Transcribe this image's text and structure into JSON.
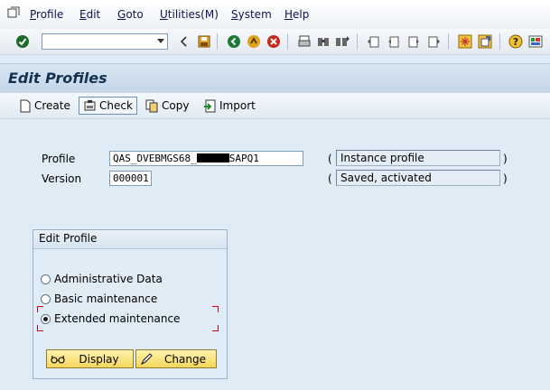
{
  "menubar": {
    "items": [
      {
        "label": "Profile"
      },
      {
        "label": "Edit"
      },
      {
        "label": "Goto"
      },
      {
        "label": "Utilities(M)"
      },
      {
        "label": "System"
      },
      {
        "label": "Help"
      }
    ]
  },
  "toolbar": {
    "command_field": "",
    "icons": [
      "enter-icon",
      "back-icon",
      "save-icon",
      "back-green-icon",
      "exit-icon",
      "cancel-icon",
      "print-icon",
      "find-icon",
      "find-next-icon",
      "first-page-icon",
      "prev-page-icon",
      "next-page-icon",
      "last-page-icon",
      "new-session-icon",
      "shortcut-icon",
      "help-icon",
      "customize-icon"
    ]
  },
  "title": "Edit Profiles",
  "app_toolbar": {
    "create": "Create",
    "check": "Check",
    "copy": "Copy",
    "import": "Import"
  },
  "form": {
    "profile_label": "Profile",
    "profile_value_prefix": "QAS_DVEBMGS68_",
    "profile_value_suffix": "SAPQ1",
    "profile_type": "Instance profile",
    "version_label": "Version",
    "version_value": "000001",
    "version_status": "Saved, activated",
    "paren_open": "(",
    "paren_close": ")"
  },
  "edit_profile": {
    "header": "Edit Profile",
    "options": [
      {
        "label": "Administrative Data",
        "selected": false
      },
      {
        "label": "Basic maintenance",
        "selected": false
      },
      {
        "label": "Extended maintenance",
        "selected": true
      }
    ],
    "display_button": "Display",
    "change_button": "Change"
  },
  "colors": {
    "background": "#dfebf5",
    "button_yellow": "#f5d75a",
    "focus_red": "#d0021b"
  }
}
